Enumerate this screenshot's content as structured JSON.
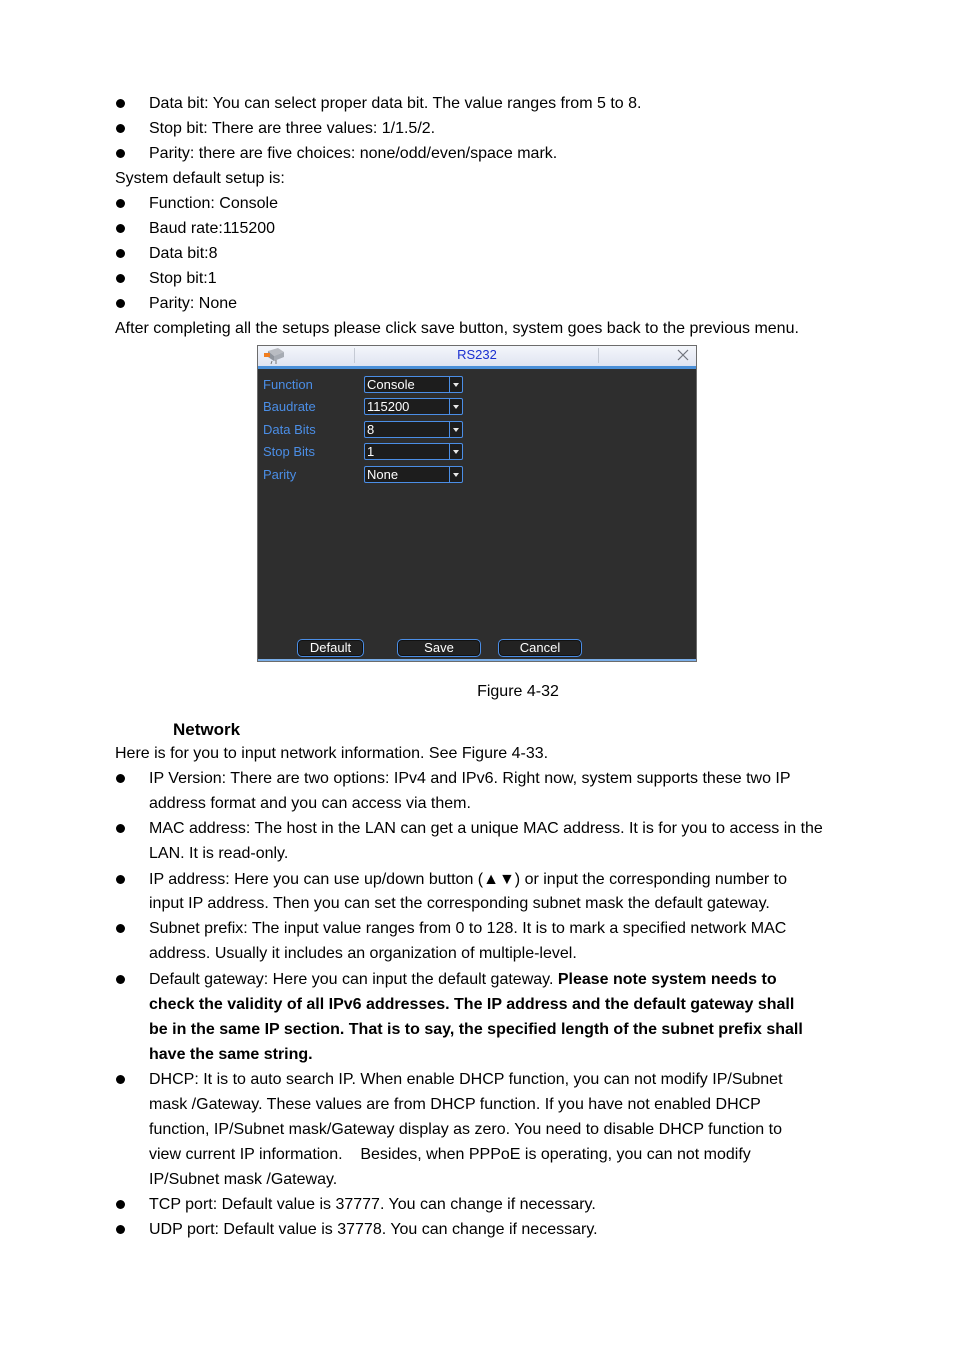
{
  "intro_bullets": [
    "Data bit: You can select proper data bit. The value ranges from 5 to 8.",
    "Stop bit: There are three values: 1/1.5/2.",
    "Parity: there are five choices: none/odd/even/space mark."
  ],
  "default_setup_label": "System default setup is:",
  "default_bullets": [
    "Function: Console",
    "Baud rate:115200",
    "Data bit:8",
    "Stop bit:1",
    "Parity: None"
  ],
  "after_setup_text": "After completing all the setups please click save button, system goes back to the previous menu.",
  "dialog": {
    "title": "RS232",
    "fields": [
      {
        "label": "Function",
        "value": "Console"
      },
      {
        "label": "Baudrate",
        "value": "115200"
      },
      {
        "label": "Data Bits",
        "value": "8"
      },
      {
        "label": "Stop Bits",
        "value": "1"
      },
      {
        "label": "Parity",
        "value": "None"
      }
    ],
    "buttons": {
      "default": "Default",
      "save": "Save",
      "cancel": "Cancel"
    },
    "colors": {
      "label": "#4b8ee6",
      "title": "#1a2fd0",
      "background": "#2e2e2e"
    }
  },
  "figure_caption": "Figure 4-32",
  "section_heading": "Network",
  "network_intro": "Here is for you to input network information. See Figure 4-33.",
  "network_bullets": [
    {
      "lines": [
        "IP Version: There are two options: IPv4 and IPv6. Right now, system supports these two IP",
        "address format and you can access via them."
      ]
    },
    {
      "lines": [
        "MAC address: The host in the LAN can get a unique MAC address. It is for you to access in the",
        "LAN. It is read-only."
      ]
    },
    {
      "lines": [
        "IP address: Here you can use up/down button (▲▼) or input the corresponding number to",
        "input IP address. Then you can set the corresponding subnet mask the default gateway."
      ]
    },
    {
      "lines": [
        "Subnet prefix: The input value ranges from 0 to 128. It is to mark a specified network MAC",
        "address. Usually it includes an organization of multiple-level."
      ]
    },
    {
      "first_normal": "Default gateway: Here you can input the default gateway. ",
      "first_bold": "Please note system needs to",
      "bold_lines": [
        "check the validity of all IPv6 addresses. The IP address and the default gateway shall",
        "be in the same IP section. That is to say, the specified length of the subnet prefix shall",
        "have the same string."
      ]
    },
    {
      "lines": [
        "DHCP: It is to auto search IP. When enable DHCP function, you can not modify IP/Subnet",
        "mask /Gateway. These values are from DHCP function. If you have not enabled DHCP",
        "function, IP/Subnet mask/Gateway display as zero. You need to disable DHCP function to",
        "view current IP information.    Besides, when PPPoE is operating, you can not modify",
        "IP/Subnet mask /Gateway."
      ]
    },
    {
      "lines": [
        "TCP port: Default value is 37777. You can change if necessary."
      ]
    },
    {
      "lines": [
        "UDP port: Default value is 37778. You can change if necessary."
      ]
    }
  ]
}
